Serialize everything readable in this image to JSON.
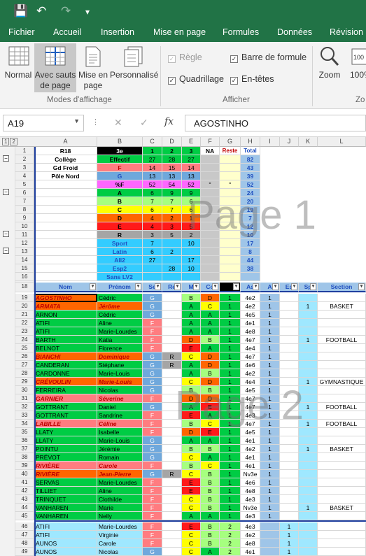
{
  "qat": {
    "save": "💾",
    "undo": "↶",
    "redo": "↷",
    "more": "▾"
  },
  "tabs": [
    "Fichier",
    "Accueil",
    "Insertion",
    "Mise en page",
    "Formules",
    "Données",
    "Révision"
  ],
  "ribbon": {
    "normal": "Normal",
    "avec": "Avec sauts de page",
    "mep": "Mise en page",
    "perso": "Personnalisé",
    "grp1": "Modes d'affichage",
    "regle": "Règle",
    "barre": "Barre de formule",
    "quad": "Quadrillage",
    "entetes": "En-têtes",
    "grp2": "Afficher",
    "zoom": "Zoom",
    "pct": "100%",
    "zo": "Zo"
  },
  "formula": {
    "name": "A19",
    "cancel": "✕",
    "enter": "✓",
    "fx": "fx",
    "value": "AGOSTINHO"
  },
  "columns": [
    "A",
    "B",
    "C",
    "D",
    "E",
    "F",
    "G",
    "H",
    "I",
    "J",
    "K",
    "L"
  ],
  "summary": {
    "title": "R18",
    "class": "3e",
    "college": "Collège",
    "gdfroid": "Gd Froid",
    "pole": "Pôle Nord",
    "effectif": "Effectif",
    "h1": "1",
    "h2": "2",
    "h3": "3",
    "na": "NA",
    "reste": "Reste",
    "total": "Total",
    "rows": [
      [
        "Effectif",
        "27",
        "28",
        "27",
        "",
        "",
        "82"
      ],
      [
        "F",
        "14",
        "15",
        "14",
        "",
        "",
        "43"
      ],
      [
        "G",
        "13",
        "13",
        "13",
        "",
        "",
        "39"
      ],
      [
        "%F",
        "52",
        "54",
        "52",
        "\"",
        "\"",
        "52"
      ],
      [
        "A",
        "6",
        "9",
        "9",
        "",
        "",
        "24"
      ],
      [
        "B",
        "7",
        "7",
        "6",
        "",
        "",
        "20"
      ],
      [
        "C",
        "6",
        "7",
        "6",
        "",
        "",
        "19"
      ],
      [
        "D",
        "4",
        "2",
        "1",
        "",
        "",
        "7"
      ],
      [
        "E",
        "4",
        "3",
        "5",
        "",
        "",
        "12"
      ],
      [
        "R",
        "3",
        "5",
        "2",
        "",
        "",
        "10"
      ],
      [
        "Sport",
        "7",
        "",
        "10",
        "",
        "",
        "17"
      ],
      [
        "Latin",
        "6",
        "2",
        "",
        "",
        "",
        "8"
      ],
      [
        "All2",
        "27",
        "",
        "17",
        "",
        "",
        "44"
      ],
      [
        "Esp2",
        "",
        "28",
        "10",
        "",
        "",
        "38"
      ],
      [
        "Sans LV2",
        "",
        "",
        "",
        "",
        "",
        ""
      ]
    ]
  },
  "headers": [
    "Nom",
    "Prénom",
    "Se",
    "Re",
    "M",
    "Co",
    "",
    "As",
    "A",
    "Es",
    "Sp",
    "Section"
  ],
  "students": [
    [
      "19",
      "AGOSTINHO",
      "Cédric",
      "G",
      "",
      "B",
      "D",
      "1",
      "4e2",
      "1",
      "",
      "",
      ""
    ],
    [
      "20",
      "ARMATA",
      "Jérôme",
      "G",
      "",
      "A",
      "C",
      "1",
      "4e2",
      "1",
      "",
      "1",
      "BASKET"
    ],
    [
      "21",
      "ARNON",
      "Cédric",
      "G",
      "",
      "A",
      "A",
      "1",
      "4e5",
      "1",
      "",
      "",
      ""
    ],
    [
      "22",
      "ATIFI",
      "Aline",
      "F",
      "",
      "A",
      "A",
      "1",
      "4e1",
      "1",
      "",
      "",
      ""
    ],
    [
      "23",
      "ATIFI",
      "Marie-Lourdes",
      "F",
      "",
      "A",
      "A",
      "1",
      "4e8",
      "1",
      "",
      "",
      ""
    ],
    [
      "24",
      "BARTH",
      "Katia",
      "F",
      "",
      "D",
      "B",
      "1",
      "4e7",
      "1",
      "",
      "1",
      "FOOTBALL"
    ],
    [
      "25",
      "BELNOT",
      "Florence",
      "F",
      "",
      "E",
      "A",
      "1",
      "4e4",
      "1",
      "",
      "",
      ""
    ],
    [
      "26",
      "BIANCHI",
      "Dominique",
      "G",
      "R",
      "C",
      "D",
      "1",
      "4e7",
      "1",
      "",
      "",
      ""
    ],
    [
      "27",
      "CANDERAN",
      "Stéphane",
      "G",
      "R",
      "A",
      "D",
      "1",
      "4e6",
      "1",
      "",
      "",
      ""
    ],
    [
      "28",
      "CARDONNE",
      "Marie-Louis",
      "G",
      "",
      "A",
      "B",
      "1",
      "4e2",
      "1",
      "",
      "",
      ""
    ],
    [
      "29",
      "CRÉVOULIN",
      "Marie-Louis",
      "G",
      "",
      "C",
      "D",
      "1",
      "4e4",
      "1",
      "",
      "1",
      "GYMNASTIQUE"
    ],
    [
      "30",
      "FERREIRA",
      "Nicolas",
      "G",
      "",
      "B",
      "B",
      "1",
      "4e5",
      "1",
      "",
      "",
      ""
    ],
    [
      "31",
      "GARNIER",
      "Séverine",
      "F",
      "",
      "D",
      "D",
      "1",
      "4e7",
      "1",
      "",
      "",
      ""
    ],
    [
      "32",
      "GOTTRANT",
      "Daniel",
      "G",
      "",
      "A",
      "E",
      "1",
      "4e7",
      "1",
      "",
      "1",
      "FOOTBALL"
    ],
    [
      "33",
      "GOTTRANT",
      "Sandrine",
      "F",
      "",
      "E",
      "A",
      "1",
      "4e3",
      "1",
      "",
      "",
      ""
    ],
    [
      "34",
      "LABILLE",
      "Céline",
      "F",
      "",
      "B",
      "C",
      "1",
      "4e7",
      "1",
      "",
      "1",
      "FOOTBALL"
    ],
    [
      "35",
      "LLATY",
      "Isabelle",
      "F",
      "",
      "D",
      "E",
      "1",
      "4e5",
      "1",
      "",
      "",
      ""
    ],
    [
      "36",
      "LLATY",
      "Marie-Louis",
      "G",
      "",
      "A",
      "A",
      "1",
      "4e1",
      "1",
      "",
      "",
      ""
    ],
    [
      "37",
      "POINTU",
      "Jérémie",
      "G",
      "",
      "B",
      "B",
      "1",
      "4e2",
      "1",
      "",
      "1",
      "BASKET"
    ],
    [
      "38",
      "PRÉVOT",
      "Romain",
      "G",
      "",
      "C",
      "A",
      "1",
      "4e1",
      "1",
      "",
      "",
      ""
    ],
    [
      "39",
      "RIVIÈRE",
      "Carole",
      "F",
      "",
      "B",
      "C",
      "1",
      "4e1",
      "1",
      "",
      "",
      ""
    ],
    [
      "40",
      "RIVIÈRE",
      "Jean-Pierre",
      "G",
      "R",
      "C",
      "B",
      "1",
      "Nv3e",
      "1",
      "",
      "",
      ""
    ],
    [
      "41",
      "SERVAS",
      "Marie-Lourdes",
      "F",
      "",
      "E",
      "B",
      "1",
      "4e6",
      "1",
      "",
      "",
      ""
    ],
    [
      "42",
      "TILLIET",
      "Aline",
      "F",
      "",
      "E",
      "B",
      "1",
      "4e8",
      "1",
      "",
      "",
      ""
    ],
    [
      "43",
      "TRINQUET",
      "Clothilde",
      "F",
      "",
      "C",
      "B",
      "1",
      "4e3",
      "1",
      "",
      "",
      ""
    ],
    [
      "44",
      "VANHAREN",
      "Marie",
      "F",
      "",
      "C",
      "B",
      "1",
      "Nv3e",
      "1",
      "",
      "1",
      "BASKET"
    ],
    [
      "45",
      "VANHAREN",
      "Nelly",
      "F",
      "",
      "A",
      "A",
      "1",
      "4e3",
      "1",
      "",
      "",
      ""
    ],
    [
      "46",
      "ATIFI",
      "Marie-Lourdes",
      "F",
      "",
      "E",
      "B",
      "2",
      "4e3",
      "",
      "1",
      "",
      ""
    ],
    [
      "47",
      "ATIFI",
      "Virginie",
      "F",
      "",
      "C",
      "B",
      "2",
      "4e2",
      "",
      "1",
      "",
      ""
    ],
    [
      "48",
      "AUNOS",
      "Carole",
      "F",
      "",
      "C",
      "B",
      "2",
      "4e8",
      "",
      "1",
      "",
      ""
    ],
    [
      "49",
      "AUNOS",
      "Nicolas",
      "G",
      "",
      "C",
      "A",
      "2",
      "4e1",
      "",
      "1",
      "",
      ""
    ]
  ],
  "watermarks": [
    "Page 1",
    "Page 2"
  ],
  "colors": {
    "green": "#217346",
    "F": "#ff7c80",
    "G": "#6fa8dc",
    "A": "#00cc44",
    "B": "#a6ff7f",
    "C": "#ffff00",
    "D": "#ff6600",
    "E": "#ff1a1a"
  }
}
